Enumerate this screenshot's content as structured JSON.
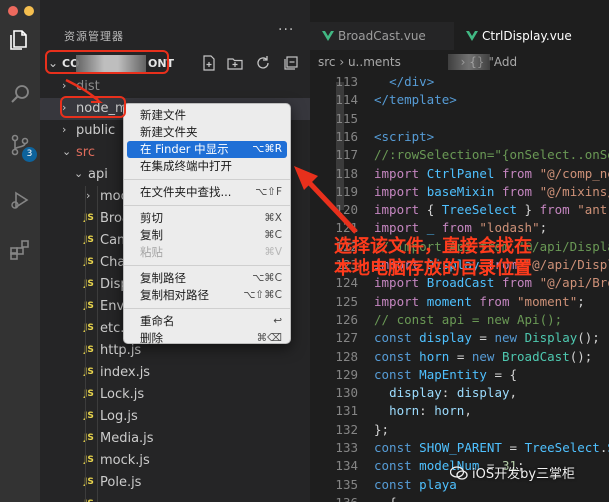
{
  "window": {
    "dots": [
      "#ed6a5e",
      "#f5bf4f",
      "#61c554"
    ]
  },
  "activity_bar": {
    "icons": [
      "explorer-icon",
      "search-icon",
      "source-control-icon",
      "run-debug-icon",
      "extensions-icon"
    ],
    "scm_badge": "3"
  },
  "sidebar": {
    "title": "资源管理器",
    "more": "···",
    "project_prefix": "CO",
    "project_suffix": "ONT",
    "toolbar_icons": [
      "new-file-icon",
      "new-folder-icon",
      "refresh-icon",
      "collapse-all-icon"
    ],
    "tree": [
      {
        "label": "dist",
        "kind": "folder-closed",
        "indent": 1,
        "style": "dim"
      },
      {
        "label": "node_m",
        "kind": "folder-closed",
        "indent": 1,
        "style": "normal"
      },
      {
        "label": "public",
        "kind": "folder-closed",
        "indent": 1,
        "style": "normal"
      },
      {
        "label": "src",
        "kind": "folder-open",
        "indent": 1,
        "style": "red"
      },
      {
        "label": "api",
        "kind": "folder-open",
        "indent": 2,
        "style": "normal"
      },
      {
        "label": "mock",
        "kind": "folder-closed",
        "indent": 3,
        "style": "normal"
      },
      {
        "label": "Broa",
        "kind": "js",
        "indent": 3,
        "style": "normal"
      },
      {
        "label": "Cam",
        "kind": "js",
        "indent": 3,
        "style": "normal"
      },
      {
        "label": "Char",
        "kind": "js",
        "indent": 3,
        "style": "normal"
      },
      {
        "label": "Disp",
        "kind": "js",
        "indent": 3,
        "style": "normal"
      },
      {
        "label": "Envi",
        "kind": "js",
        "indent": 3,
        "style": "normal"
      },
      {
        "label": "etc.j",
        "kind": "js",
        "indent": 3,
        "style": "normal"
      },
      {
        "label": "http.js",
        "kind": "js",
        "indent": 3,
        "style": "normal"
      },
      {
        "label": "index.js",
        "kind": "js",
        "indent": 3,
        "style": "normal"
      },
      {
        "label": "Lock.js",
        "kind": "js",
        "indent": 3,
        "style": "normal"
      },
      {
        "label": "Log.js",
        "kind": "js",
        "indent": 3,
        "style": "normal"
      },
      {
        "label": "Media.js",
        "kind": "js",
        "indent": 3,
        "style": "normal"
      },
      {
        "label": "mock.js",
        "kind": "js",
        "indent": 3,
        "style": "normal"
      },
      {
        "label": "Pole.js",
        "kind": "js",
        "indent": 3,
        "style": "normal"
      },
      {
        "label": "",
        "kind": "js",
        "indent": 3,
        "style": "normal"
      }
    ]
  },
  "editor": {
    "tabs": [
      {
        "label": "BroadCast.vue",
        "active": false
      },
      {
        "label": "CtrlDisplay.vue",
        "active": true
      }
    ],
    "breadcrumb": {
      "part1": "src › ",
      "part2": "u..ments",
      "part3": " › {} \"Add"
    },
    "line_numbers": [
      "113",
      "114",
      "115",
      "116",
      "117",
      "118",
      "119",
      "120",
      "121",
      "122",
      "123",
      "124",
      "125",
      "126",
      "127",
      "128",
      "129",
      "130",
      "131",
      "132",
      "133",
      "134",
      "135",
      "136"
    ]
  },
  "context_menu": {
    "groups": [
      [
        {
          "label": "新建文件",
          "shortcut": "",
          "state": "normal"
        },
        {
          "label": "新建文件夹",
          "shortcut": "",
          "state": "normal"
        },
        {
          "label": "在 Finder 中显示",
          "shortcut": "⌥⌘R",
          "state": "highlighted"
        },
        {
          "label": "在集成终端中打开",
          "shortcut": "",
          "state": "normal"
        }
      ],
      [
        {
          "label": "在文件夹中查找...",
          "shortcut": "⌥⇧F",
          "state": "normal"
        }
      ],
      [
        {
          "label": "剪切",
          "shortcut": "⌘X",
          "state": "normal"
        },
        {
          "label": "复制",
          "shortcut": "⌘C",
          "state": "normal"
        },
        {
          "label": "粘贴",
          "shortcut": "⌘V",
          "state": "disabled"
        }
      ],
      [
        {
          "label": "复制路径",
          "shortcut": "⌥⌘C",
          "state": "normal"
        },
        {
          "label": "复制相对路径",
          "shortcut": "⌥⇧⌘C",
          "state": "normal"
        }
      ],
      [
        {
          "label": "重命名",
          "shortcut": "↩",
          "state": "normal"
        },
        {
          "label": "删除",
          "shortcut": "⌘⌫",
          "state": "normal"
        }
      ]
    ]
  },
  "annotation": {
    "line1": "选择该文件，直接会找在",
    "line2": "本地电脑存放的目录位置"
  },
  "watermark": "iOS开发by三掌柜",
  "colors": {
    "annotation_red": "#e8301c",
    "menu_highlight": "#1f6fd6",
    "vue_green": "#41b883"
  }
}
